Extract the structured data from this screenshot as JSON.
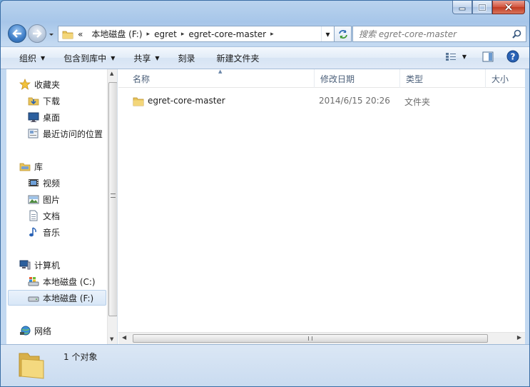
{
  "address": {
    "overflow": "«",
    "segments": [
      "本地磁盘 (F:)",
      "egret",
      "egret-core-master"
    ],
    "dropdown_glyph": "▾",
    "sep_glyph": "▸"
  },
  "search": {
    "placeholder": "搜索 egret-core-master"
  },
  "toolbar": {
    "items": [
      "组织",
      "包含到库中",
      "共享",
      "刻录",
      "新建文件夹"
    ]
  },
  "nav": {
    "favorites": "收藏夹",
    "downloads": "下载",
    "desktop": "桌面",
    "recent": "最近访问的位置",
    "libraries": "库",
    "videos": "视频",
    "pictures": "图片",
    "documents": "文档",
    "music": "音乐",
    "computer": "计算机",
    "drive_c": "本地磁盘 (C:)",
    "drive_f": "本地磁盘 (F:)",
    "network": "网络"
  },
  "columns": {
    "name": "名称",
    "modified": "修改日期",
    "type": "类型",
    "size": "大小"
  },
  "files": [
    {
      "name": "egret-core-master",
      "modified": "2014/6/15 20:26",
      "type": "文件夹"
    }
  ],
  "status": {
    "count": "1 个对象"
  },
  "colors": {
    "folder": "#e8c45a",
    "accent": "#3d7dc7",
    "close": "#c13a22"
  },
  "icons": [
    "minimize-icon",
    "maximize-icon",
    "close-icon",
    "back-arrow-icon",
    "forward-arrow-icon",
    "refresh-icon",
    "search-icon",
    "view-icon",
    "preview-pane-icon",
    "help-icon",
    "folder-icon",
    "star-icon",
    "monitor-icon",
    "drive-icon",
    "network-icon"
  ]
}
